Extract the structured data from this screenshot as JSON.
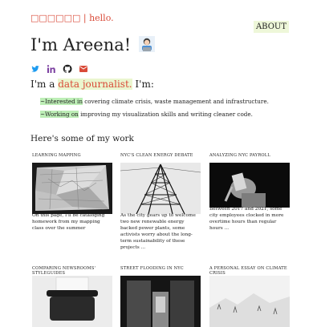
{
  "header": {
    "brand": "□□□□□□",
    "separator": " | ",
    "greeting": "hello.",
    "about_label": "ABOUT"
  },
  "hero": {
    "title": "I'm Areena!",
    "emoji_icon": "woman-technologist-icon"
  },
  "socials": [
    {
      "icon": "twitter-icon"
    },
    {
      "icon": "linkedin-icon"
    },
    {
      "icon": "github-icon"
    },
    {
      "icon": "email-icon"
    }
  ],
  "intro": {
    "prefix": "I'm a ",
    "role": "data journalist.",
    "suffix": " I'm:"
  },
  "bullets": [
    {
      "mark": "~Interested in",
      "text": " covering climate crisis, waste management and infrastructure."
    },
    {
      "mark": "~Working on",
      "text": " improving my visualization skills and writing cleaner code."
    }
  ],
  "work": {
    "heading": "Here's some of my work",
    "cards": [
      {
        "title": "LEARNING MAPPING",
        "desc": "On this page, I'll be cataloging homework from my mapping class over the summer"
      },
      {
        "title": "NYC'S CLEAN ENERGY DEBATE",
        "desc": "As the city gears up to welcome two new renewable energy backed power plants, some activists worry about the long-term sustainability of these projects ..."
      },
      {
        "title": "ANALYZING NYC PAYROLL",
        "desc": "Between 2017 and 2021, some city employees clocked in more overtime hours than regular hours ..."
      },
      {
        "title": "COMPARING NEWSROOMS' STYLEGUIDES",
        "desc": ""
      },
      {
        "title": "STREET FLOODING IN NYC",
        "desc": ""
      },
      {
        "title": "A PERSONAL ESSAY ON CLIMATE CRISIS",
        "desc": ""
      }
    ]
  },
  "colors": {
    "accent": "#d94a38",
    "highlight_green": "#bdeeb6",
    "highlight_light": "#eaf6cf"
  }
}
